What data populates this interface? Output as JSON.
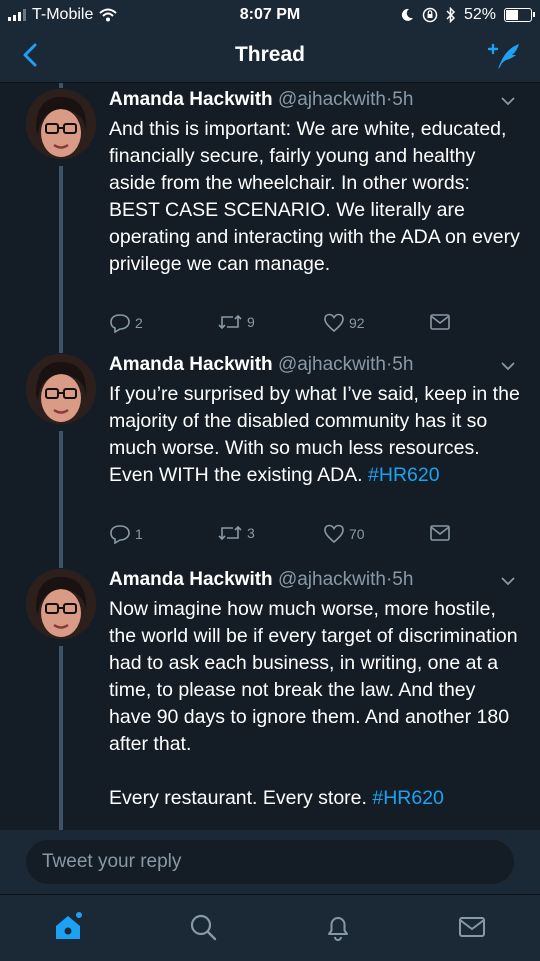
{
  "status_bar": {
    "carrier": "T-Mobile",
    "time": "8:07 PM",
    "battery": "52%"
  },
  "nav": {
    "title": "Thread"
  },
  "tweets": [
    {
      "name": "Amanda Hackwith",
      "handle": "@ajhackwith",
      "time": "5h",
      "text": "And this is important: We are white, educated, financially secure, fairly young and healthy aside from the wheelchair. In other words: BEST CASE SCENARIO. We literally are operating and interacting with the ADA on every privilege we can manage.",
      "hashtag": "",
      "replies": "2",
      "retweets": "9",
      "likes": "92"
    },
    {
      "name": "Amanda Hackwith",
      "handle": "@ajhackwith",
      "time": "5h",
      "text": "If you’re surprised by what I’ve said, keep in the majority of the disabled community has it so much worse. With so much less resources. Even WITH the existing ADA. ",
      "hashtag": "#HR620",
      "replies": "1",
      "retweets": "3",
      "likes": "70"
    },
    {
      "name": "Amanda Hackwith",
      "handle": "@ajhackwith",
      "time": "5h",
      "text": "Now imagine how much worse, more hostile, the world will be if every target of discrimination had to ask each business, in writing, one at a time, to please not break the law. And they have 90 days to ignore them. And another 180 after that.\n\nEvery restaurant. Every store. ",
      "hashtag": "#HR620",
      "replies": "",
      "retweets": "",
      "likes": ""
    }
  ],
  "reply_box": {
    "placeholder": "Tweet your reply"
  },
  "icons": {
    "back": "chevron-left-icon",
    "compose": "compose-tweet-icon",
    "home": "home-icon",
    "search": "search-icon",
    "notifications": "bell-icon",
    "messages": "envelope-icon"
  },
  "colors": {
    "accent": "#1da1f2",
    "background": "#141d26",
    "secondary_text": "#8899a6"
  }
}
